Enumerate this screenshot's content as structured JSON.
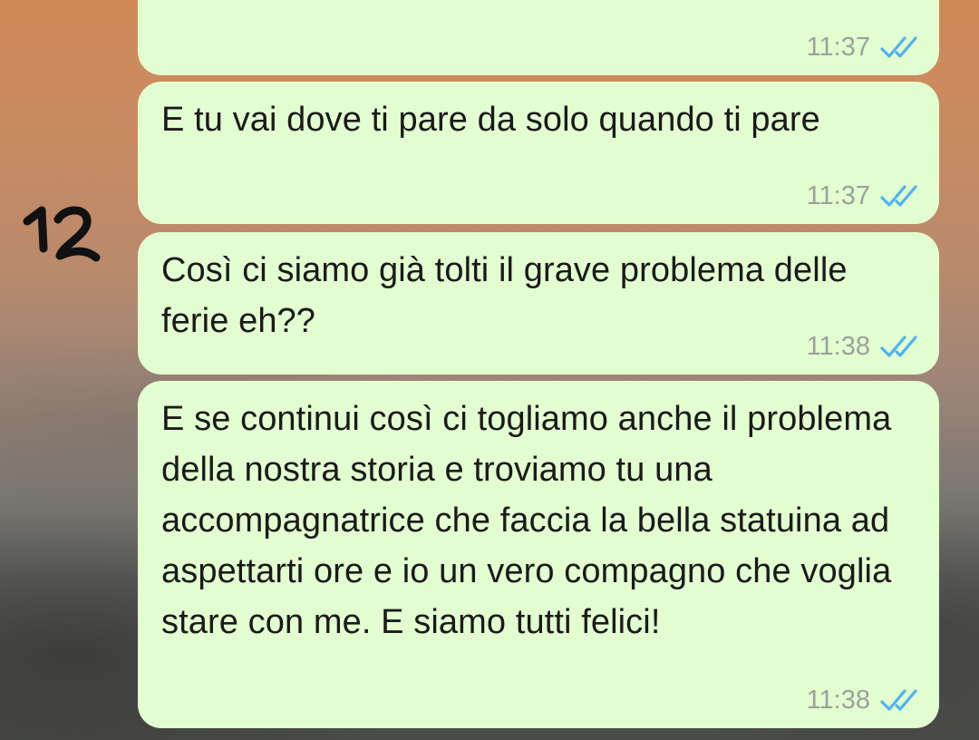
{
  "annotation": {
    "label": "12"
  },
  "messages": [
    {
      "text": "",
      "time": "11:37",
      "status_icon": "double-check-read-icon"
    },
    {
      "text": "E tu vai dove ti pare da solo quando ti pare",
      "time": "11:37",
      "status_icon": "double-check-read-icon"
    },
    {
      "text": "Così ci siamo già tolti il grave problema delle ferie eh??",
      "time": "11:38",
      "status_icon": "double-check-read-icon"
    },
    {
      "text": "E se continui così ci togliamo anche il problema della nostra storia e troviamo tu una accompagnatrice che faccia la bella statuina ad aspettarti ore e io un vero compagno che voglia stare con me. E siamo tutti felici!",
      "time": "11:38",
      "status_icon": "double-check-read-icon"
    }
  ],
  "colors": {
    "bubble_outgoing": "#e2fdd0",
    "read_tick": "#4fb3f0",
    "timestamp": "#9aa29a"
  }
}
